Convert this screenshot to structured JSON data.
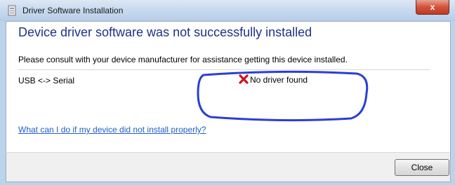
{
  "window": {
    "title": "Driver Software Installation",
    "close_glyph": "x"
  },
  "dialog": {
    "headline": "Device driver software was not successfully installed",
    "description": "Please consult with your device manufacturer for assistance getting this device installed.",
    "device_name": "USB <-> Serial",
    "status_text": "No driver found",
    "status_icon": "red-x-icon",
    "help_link": "What can I do if my device did not install properly?",
    "close_button_label": "Close"
  },
  "colors": {
    "headline": "#1e3287",
    "link": "#1f5ec6",
    "error_icon": "#d0121a",
    "annotation": "#2b3fd1"
  }
}
